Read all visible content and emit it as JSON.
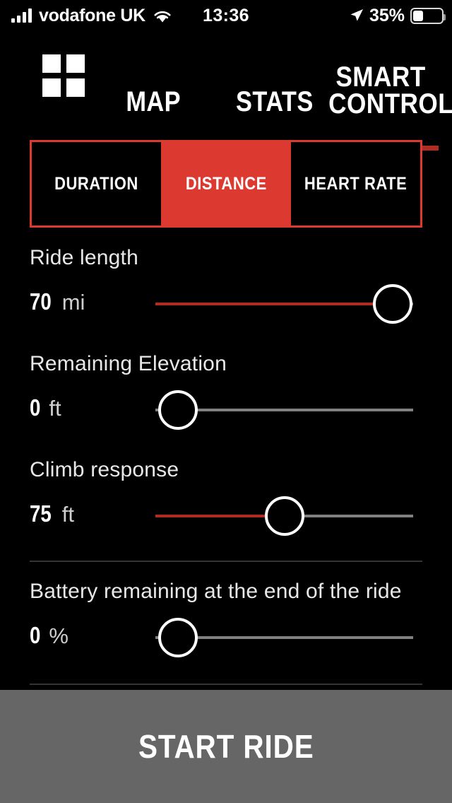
{
  "theme": {
    "bg": "#000000",
    "accent_red": "#B02B20",
    "accent_red_bright": "#DC3A30",
    "track_gray": "#808080",
    "button_gray": "#666666",
    "divider": "#343434"
  },
  "status_bar": {
    "carrier": "vodafone UK",
    "wifi_icon": "wifi-icon",
    "time": "13:36",
    "location_icon": "location-arrow-icon",
    "battery_percent": "35%",
    "battery_level": 35,
    "signal_icon": "cellular-signal-icon",
    "battery_icon": "battery-icon"
  },
  "nav": {
    "grid_icon": "grid-menu-icon",
    "tabs": [
      {
        "label": "MAP",
        "active": false
      },
      {
        "label": "STATS",
        "active": false
      },
      {
        "label": "SMART\nCONTROL",
        "line1": "SMART",
        "line2": "CONTROL",
        "active": true
      }
    ]
  },
  "segmented_control": {
    "options": [
      {
        "label": "DURATION",
        "selected": false
      },
      {
        "label": "DISTANCE",
        "selected": true
      },
      {
        "label": "HEART RATE",
        "selected": false
      }
    ]
  },
  "sliders": [
    {
      "label": "Ride length",
      "value": "70",
      "unit": "mi",
      "fill_percent": 92
    },
    {
      "label": "Remaining Elevation",
      "value": "0",
      "unit": "ft",
      "fill_percent": 0
    },
    {
      "label": "Climb response",
      "value": "75",
      "unit": "ft",
      "fill_percent": 50
    },
    {
      "label": "Battery remaining at the end of the ride",
      "value": "0",
      "unit": "%",
      "fill_percent": 0
    }
  ],
  "primary_action": {
    "label": "START RIDE"
  }
}
